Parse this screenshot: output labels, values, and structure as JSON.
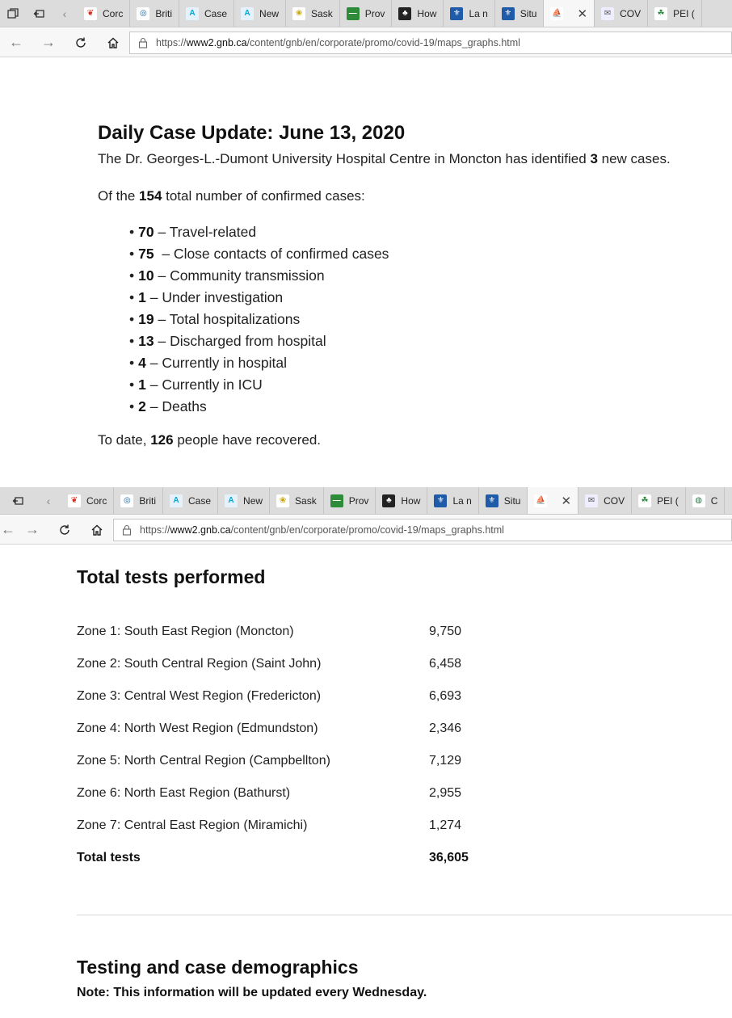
{
  "browser_top": {
    "tabs": [
      {
        "label": "Corc",
        "icon": "maple-leaf-icon"
      },
      {
        "label": "Briti",
        "icon": "bc-logo-icon"
      },
      {
        "label": "Case",
        "icon": "alberta-logo-icon"
      },
      {
        "label": "New",
        "icon": "alberta-logo-icon"
      },
      {
        "label": "Sask",
        "icon": "sask-logo-icon"
      },
      {
        "label": "Prov",
        "icon": "manitoba-logo-icon"
      },
      {
        "label": "How",
        "icon": "ontario-logo-icon"
      },
      {
        "label": "La n",
        "icon": "quebec-flag-icon"
      },
      {
        "label": "Situ",
        "icon": "quebec-flag-icon"
      },
      {
        "label": "",
        "icon": "nb-logo-icon",
        "active": true
      },
      {
        "label": "COV",
        "icon": "ns-logo-icon"
      },
      {
        "label": "PEI (",
        "icon": "pei-logo-icon"
      }
    ],
    "url_prefix": "https://",
    "url_host": "www2.gnb.ca",
    "url_path": "/content/gnb/en/corporate/promo/covid-19/maps_graphs.html"
  },
  "browser_bottom": {
    "tabs": [
      {
        "label": "Corc",
        "icon": "maple-leaf-icon"
      },
      {
        "label": "Briti",
        "icon": "bc-logo-icon"
      },
      {
        "label": "Case",
        "icon": "alberta-logo-icon"
      },
      {
        "label": "New",
        "icon": "alberta-logo-icon"
      },
      {
        "label": "Sask",
        "icon": "sask-logo-icon"
      },
      {
        "label": "Prov",
        "icon": "manitoba-logo-icon"
      },
      {
        "label": "How",
        "icon": "ontario-logo-icon"
      },
      {
        "label": "La n",
        "icon": "quebec-flag-icon"
      },
      {
        "label": "Situ",
        "icon": "quebec-flag-icon"
      },
      {
        "label": "",
        "icon": "nb-logo-icon",
        "active": true
      },
      {
        "label": "COV",
        "icon": "ns-logo-icon"
      },
      {
        "label": "PEI (",
        "icon": "pei-logo-icon"
      },
      {
        "label": "C",
        "icon": "globe-icon"
      }
    ],
    "url_prefix": "https://",
    "url_host": "www2.gnb.ca",
    "url_path": "/content/gnb/en/corporate/promo/covid-19/maps_graphs.html"
  },
  "update": {
    "title": "Daily Case Update: June 13, 2020",
    "intro_before": "The Dr. Georges-L.-Dumont University Hospital Centre in Moncton has identified ",
    "intro_count": "3",
    "intro_after": " new cases.",
    "total_before": "Of the ",
    "total_count": "154",
    "total_after": " total number of confirmed cases:",
    "items": [
      {
        "value": "70",
        "label": " – Travel-related"
      },
      {
        "value": "75",
        "label": "  – Close contacts of confirmed cases"
      },
      {
        "value": "10",
        "label": " – Community transmission"
      },
      {
        "value": "1",
        "label": " – Under investigation"
      },
      {
        "value": "19",
        "label": " – Total hospitalizations"
      },
      {
        "value": "13",
        "label": " – Discharged from hospital"
      },
      {
        "value": "4",
        "label": " – Currently in hospital"
      },
      {
        "value": "1",
        "label": " – Currently in ICU"
      },
      {
        "value": "2",
        "label": " – Deaths"
      }
    ],
    "recovered_before": "To date, ",
    "recovered_count": "126",
    "recovered_after": " people have recovered."
  },
  "tests": {
    "title": "Total tests performed",
    "zones": [
      {
        "name": "Zone 1: South East Region (Moncton)",
        "value": "9,750"
      },
      {
        "name": "Zone 2: South Central Region (Saint John)",
        "value": "6,458"
      },
      {
        "name": "Zone 3: Central West Region (Fredericton)",
        "value": "6,693"
      },
      {
        "name": "Zone 4: North West Region (Edmundston)",
        "value": "2,346"
      },
      {
        "name": "Zone 5: North Central Region (Campbellton)",
        "value": "7,129"
      },
      {
        "name": "Zone 6: North East Region (Bathurst)",
        "value": "2,955"
      },
      {
        "name": "Zone 7: Central East Region (Miramichi)",
        "value": "1,274"
      }
    ],
    "total_label": "Total tests",
    "total_value": "36,605"
  },
  "demographics": {
    "title": "Testing and case demographics",
    "note": "Note: This information will be updated every Wednesday."
  },
  "colors": {
    "tabbar_bg": "#dcdcdc",
    "active_tab_bg": "#f7f7f7",
    "text": "#1a1a1a"
  }
}
